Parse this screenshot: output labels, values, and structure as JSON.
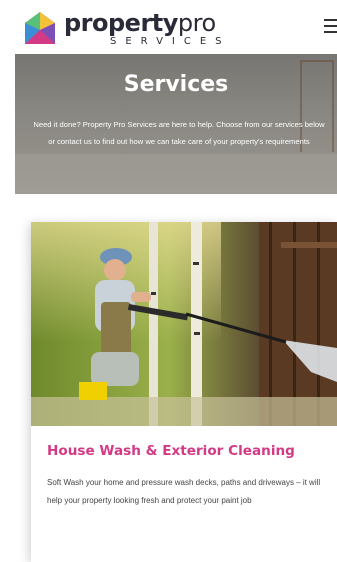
{
  "header": {
    "logo_word": "property",
    "logo_word_suffix": "pro",
    "logo_sub": "SERVICES",
    "menu_icon": "hamburger-menu-icon"
  },
  "hero": {
    "title": "Services",
    "description": "Need it done? Property Pro Services are here to help. Choose from our services below or contact us to find out how we can take care of your property's requirements"
  },
  "card": {
    "title": "House Wash & Exterior Cleaning",
    "description": "Soft Wash your home and pressure wash decks, paths and driveways – it will help your property looking fresh and protect your paint job"
  },
  "colors": {
    "accent": "#d33a86",
    "logo_text": "#2a2a38"
  }
}
